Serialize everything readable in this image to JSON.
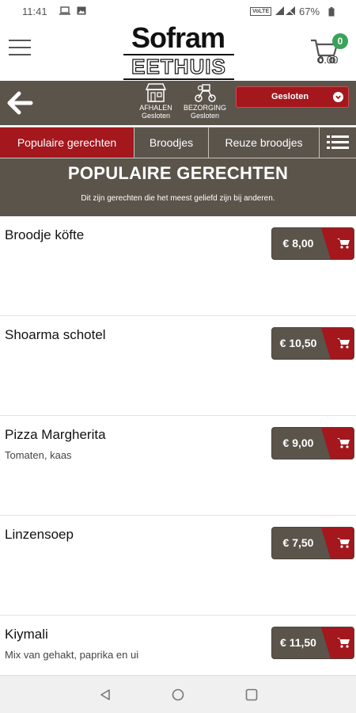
{
  "status_bar": {
    "time": "11:41",
    "network_badge": "VoLTE",
    "battery_percent": "67%"
  },
  "header": {
    "logo_line1": "Sofram",
    "logo_line2": "EETHUIS",
    "cart_count": "0",
    "cart_total": "0.00",
    "menu_icon": "hamburger-icon",
    "cart_icon": "shopping-cart-icon"
  },
  "service_bar": {
    "back_icon": "arrow-left-icon",
    "pickup_label": "AFHALEN",
    "pickup_status": "Gesloten",
    "delivery_label": "BEZORGING",
    "delivery_status": "Gesloten",
    "store_status": "Gesloten"
  },
  "tabs": [
    {
      "label": "Populaire gerechten",
      "active": true
    },
    {
      "label": "Broodjes",
      "active": false
    },
    {
      "label": "Reuze broodjes",
      "active": false
    }
  ],
  "section": {
    "title": "POPULAIRE GERECHTEN",
    "subtitle": "Dit zijn gerechten die het meest geliefd zijn bij anderen."
  },
  "items": [
    {
      "name": "Broodje köfte",
      "description": "",
      "price": "€ 8,00"
    },
    {
      "name": "Shoarma schotel",
      "description": "",
      "price": "€ 10,50"
    },
    {
      "name": "Pizza Margherita",
      "description": "Tomaten, kaas",
      "price": "€ 9,00"
    },
    {
      "name": "Linzensoep",
      "description": "",
      "price": "€ 7,50"
    },
    {
      "name": "Kiymali",
      "description": "Mix van gehakt, paprika en ui",
      "price": "€ 11,50"
    }
  ],
  "colors": {
    "brand_brown": "#5b544b",
    "brand_red": "#a3171d",
    "badge_green": "#3aa35a"
  }
}
